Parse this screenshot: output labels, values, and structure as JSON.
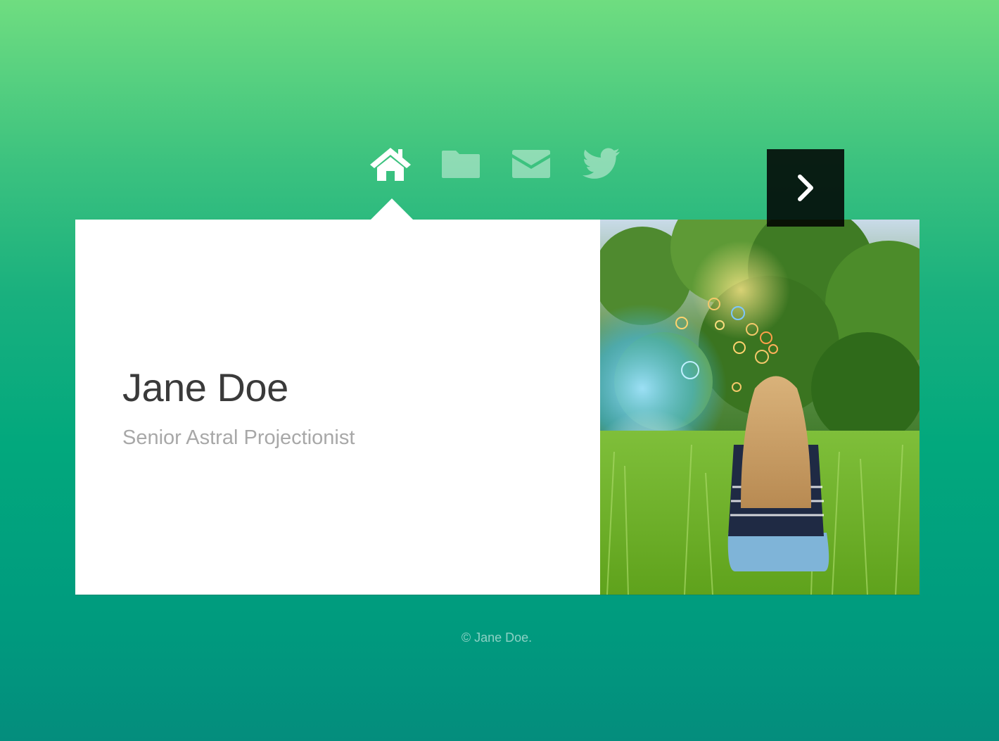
{
  "nav": {
    "items": [
      {
        "icon": "home-icon",
        "state": "active"
      },
      {
        "icon": "folder-icon",
        "state": "inactive"
      },
      {
        "icon": "envelope-icon",
        "state": "inactive"
      },
      {
        "icon": "twitter-icon",
        "state": "inactive"
      }
    ]
  },
  "intro": {
    "name": "Jane Doe",
    "role": "Senior Astral Projectionist"
  },
  "photo": {
    "next_icon": "chevron-right-icon"
  },
  "footer": {
    "copyright": "© Jane Doe."
  },
  "colors": {
    "background_top": "#6fdd80",
    "background_mid": "#02a87d",
    "background_bottom": "#048d7d",
    "panel": "#ffffff",
    "name_text": "#3a3a3a",
    "role_text": "#a8a8a8"
  }
}
